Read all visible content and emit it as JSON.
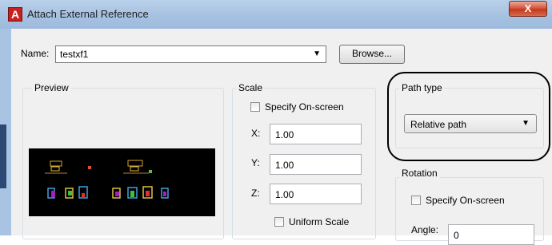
{
  "window": {
    "title": "Attach External Reference",
    "app_icon_letter": "A",
    "close_glyph": "X"
  },
  "name": {
    "label": "Name:",
    "value": "testxf1",
    "arrow": "▼"
  },
  "browse_label": "Browse...",
  "preview": {
    "title": "Preview"
  },
  "scale": {
    "title": "Scale",
    "specify_on_screen_label": "Specify On-screen",
    "specify_on_screen_checked": false,
    "x_label": "X:",
    "x_value": "1.00",
    "y_label": "Y:",
    "y_value": "1.00",
    "z_label": "Z:",
    "z_value": "1.00",
    "uniform_scale_label": "Uniform Scale",
    "uniform_scale_checked": false
  },
  "path_type": {
    "title": "Path type",
    "value": "Relative path",
    "arrow": "▼"
  },
  "rotation": {
    "title": "Rotation",
    "specify_on_screen_label": "Specify On-screen",
    "specify_on_screen_checked": false,
    "angle_label": "Angle:",
    "angle_value": "0"
  },
  "colors": {
    "annotation_ring": "#000000",
    "preview_background": "#000000"
  }
}
